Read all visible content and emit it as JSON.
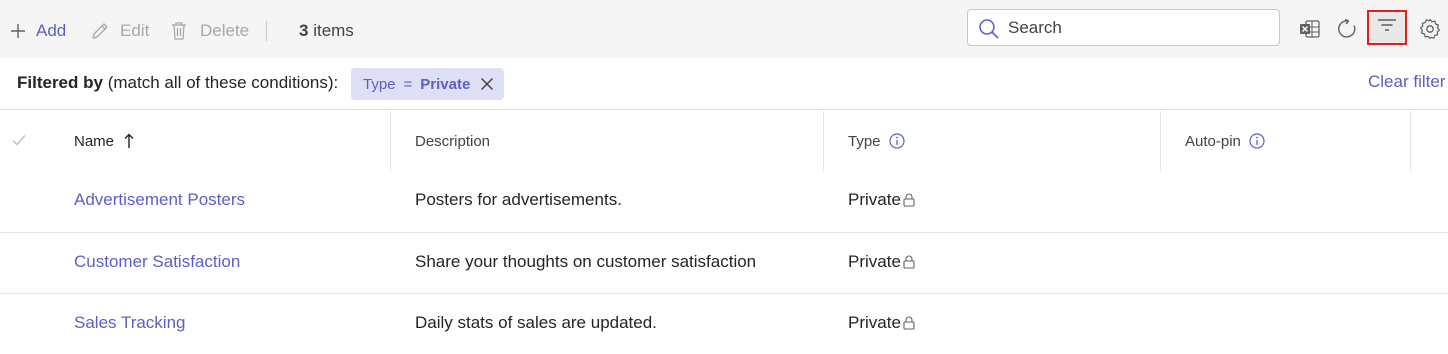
{
  "toolbar": {
    "add_label": "Add",
    "edit_label": "Edit",
    "delete_label": "Delete",
    "count_number": "3",
    "count_suffix": " items",
    "search_placeholder": "Search",
    "icons": [
      "plus-icon",
      "pencil-icon",
      "trash-icon",
      "search-icon",
      "excel-icon",
      "refresh-icon",
      "filter-icon",
      "gear-icon"
    ]
  },
  "filterbar": {
    "prefix_bold": "Filtered by",
    "prefix_rest": " (match all of these conditions):",
    "chip": {
      "field": "Type",
      "operator": "=",
      "value": "Private"
    },
    "clear_label": "Clear filter"
  },
  "table": {
    "columns": [
      {
        "label": "Name",
        "sorted": "ascending"
      },
      {
        "label": "Description"
      },
      {
        "label": "Type",
        "info": true
      },
      {
        "label": "Auto-pin",
        "info": true
      }
    ],
    "rows": [
      {
        "name": "Advertisement Posters",
        "description": "Posters for advertisements.",
        "type": "Private"
      },
      {
        "name": "Customer Satisfaction",
        "description": "Share your thoughts on customer satisfaction",
        "type": "Private"
      },
      {
        "name": "Sales Tracking",
        "description": "Daily stats of sales are updated.",
        "type": "Private"
      }
    ]
  },
  "colors": {
    "accent": "#5b5fc7",
    "chip_bg": "#dde0f5",
    "highlight": "#e02020",
    "toolbar_bg": "#f5f5f5"
  }
}
